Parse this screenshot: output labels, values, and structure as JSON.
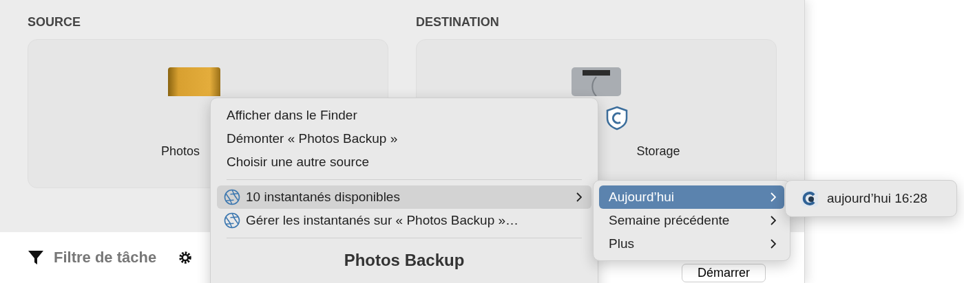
{
  "sections": [
    {
      "label": "SOURCE",
      "volume": "Photos",
      "kind": "external"
    },
    {
      "label": "DESTINATION",
      "volume": "Storage",
      "kind": "internal"
    }
  ],
  "toolbar": {
    "filter": "Filtre de tâche",
    "start_button": "Démarrer"
  },
  "context_menu": {
    "items": [
      {
        "kind": "plain",
        "label": "Afficher dans le Finder",
        "submenu": false,
        "selected": false
      },
      {
        "kind": "plain",
        "label": "Démonter « Photos Backup »",
        "submenu": false,
        "selected": false
      },
      {
        "kind": "plain",
        "label": "Choisir une autre source",
        "submenu": false,
        "selected": false
      },
      {
        "kind": "separator"
      },
      {
        "kind": "snapshot",
        "label": "10 instantanés disponibles",
        "submenu": true,
        "selected": true
      },
      {
        "kind": "snapshot",
        "label": "Gérer les instantanés sur « Photos Backup »…",
        "submenu": false,
        "selected": false
      },
      {
        "kind": "separator"
      }
    ],
    "footer": "Photos Backup"
  },
  "submenu": {
    "items": [
      {
        "label": "Aujourd’hui",
        "submenu": true,
        "selected": true
      },
      {
        "label": "Semaine précédente",
        "submenu": true,
        "selected": false
      },
      {
        "label": "Plus",
        "submenu": true,
        "selected": false
      }
    ]
  },
  "snapshot_menu": {
    "items": [
      {
        "label": "aujourd’hui 16:28",
        "selected": false
      }
    ]
  }
}
